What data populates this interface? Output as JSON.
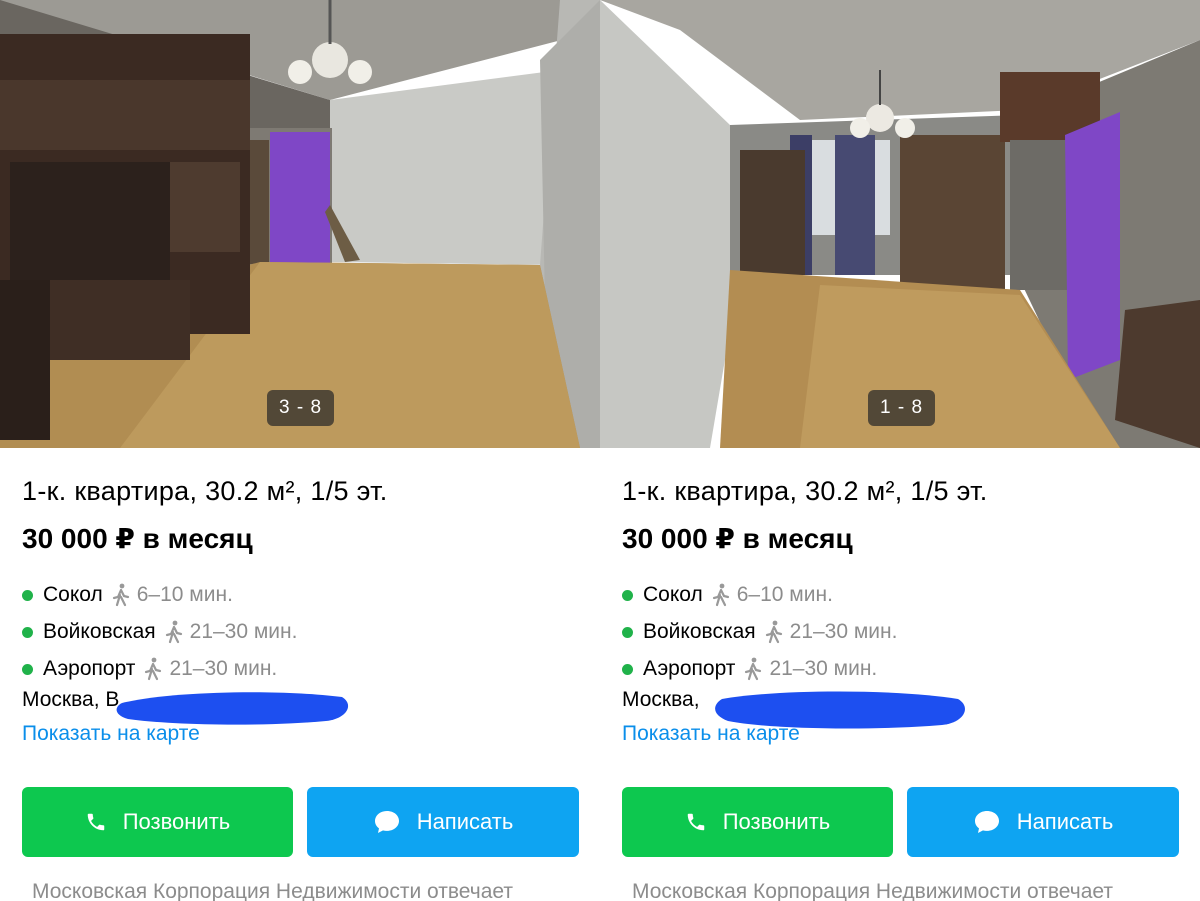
{
  "listings": [
    {
      "photo_counter": "3 - 8",
      "title": "1-к. квартира, 30.2 м², 1/5 эт.",
      "price": "30 000 ₽ в месяц",
      "metro": [
        {
          "station": "Сокол",
          "time": "6–10 мин."
        },
        {
          "station": "Войковская",
          "time": "21–30 мин."
        },
        {
          "station": "Аэропорт",
          "time": "21–30 мин."
        }
      ],
      "address": "Москва, В",
      "map_link": "Показать на карте",
      "call_label": "Позвонить",
      "message_label": "Написать",
      "seller_note": "Московская Корпорация Недвижимости отвечает"
    },
    {
      "photo_counter": "1 - 8",
      "title": "1-к. квартира, 30.2 м², 1/5 эт.",
      "price": "30 000 ₽ в месяц",
      "metro": [
        {
          "station": "Сокол",
          "time": "6–10 мин."
        },
        {
          "station": "Войковская",
          "time": "21–30 мин."
        },
        {
          "station": "Аэропорт",
          "time": "21–30 мин."
        }
      ],
      "address": "Москва, ",
      "map_link": "Показать на карте",
      "call_label": "Позвонить",
      "message_label": "Написать",
      "seller_note": "Московская Корпорация Недвижимости отвечает"
    }
  ],
  "colors": {
    "call_button": "#0dc84f",
    "message_button": "#0ea4f2",
    "link": "#0a8eea",
    "metro_line": "#20b24a",
    "redaction": "#1d4ff0"
  },
  "icons": [
    "phone-icon",
    "chat-bubble-icon",
    "walking-person-icon"
  ]
}
